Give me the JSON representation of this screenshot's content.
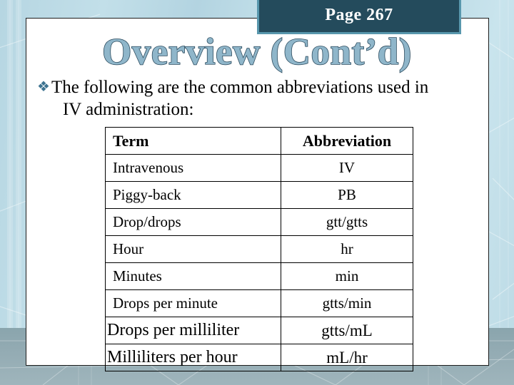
{
  "slide": {
    "page_tab_label": "Page 267",
    "title": "Overview (Cont’d)",
    "bullet_glyph": "❖",
    "body_line1": "The following are the common abbreviations used in",
    "body_line2": "IV administration:"
  },
  "table": {
    "headers": [
      "Term",
      "Abbreviation"
    ],
    "rows": [
      {
        "term": "Intravenous",
        "abbreviation": "IV"
      },
      {
        "term": "Piggy-back",
        "abbreviation": "PB"
      },
      {
        "term": "Drop/drops",
        "abbreviation": "gtt/gtts"
      },
      {
        "term": "Hour",
        "abbreviation": "hr"
      },
      {
        "term": "Minutes",
        "abbreviation": "min"
      },
      {
        "term": "Drops per minute",
        "abbreviation": "gtts/min"
      },
      {
        "term": "Drops per milliliter",
        "abbreviation": "gtts/mL"
      },
      {
        "term": "Milliliters per hour",
        "abbreviation": "mL/hr"
      }
    ]
  },
  "colors": {
    "background_light": "#c2dfe9",
    "background_band": "#93abb3",
    "tab_fill": "#244b5c",
    "tab_border": "#5897ad",
    "title_fill": "#8fb6ca",
    "title_outline": "#2c4b5e",
    "bullet": "#3d7390",
    "panel": "#ffffff",
    "rule": "#000000"
  }
}
